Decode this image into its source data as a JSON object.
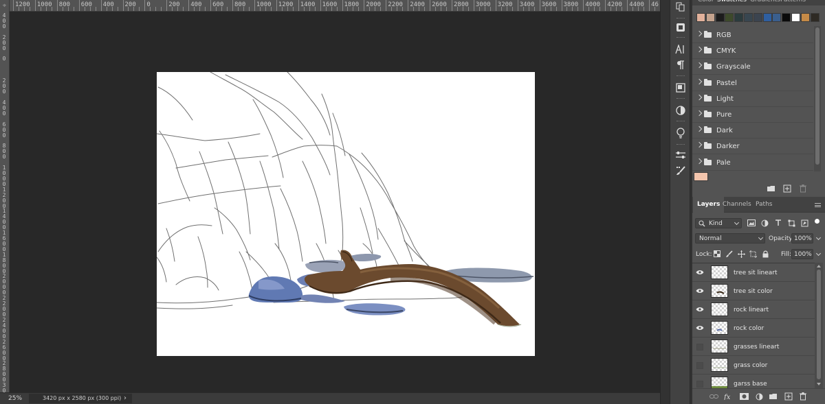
{
  "app": {
    "colors": {
      "workspace": "#282828",
      "panel": "#535353",
      "accent": "#ffffff"
    }
  },
  "ruler": {
    "horizontal_labels": [
      "1200",
      "1000",
      "800",
      "600",
      "400",
      "200",
      "0",
      "200",
      "400",
      "600",
      "800",
      "1000",
      "1200",
      "1400",
      "1600",
      "1800",
      "2000",
      "2200",
      "2400",
      "2600",
      "2800",
      "3000",
      "3200",
      "3400",
      "3600",
      "3800",
      "4000",
      "4200",
      "4400",
      "46"
    ],
    "vertical_labels": [
      "400",
      "200",
      "0",
      "200",
      "400",
      "600",
      "800",
      "1000",
      "1200",
      "1400",
      "1600",
      "1800",
      "2000",
      "2200",
      "2400",
      "2600",
      "2800",
      "3000"
    ]
  },
  "status_bar": {
    "zoom": "25%",
    "doc_info": "3420 px x 2580 px (300 ppi)",
    "arrow": "›"
  },
  "swatches_panel": {
    "tabs": [
      "Color",
      "Swatches",
      "Gradients",
      "Patterns"
    ],
    "active_tab": "Swatches",
    "recent_colors": [
      "#e2b19b",
      "#c4a38e",
      "#1c1c1c",
      "#3d4a2b",
      "#2b3b3d",
      "#384650",
      "#3b444f",
      "#2f5fa0",
      "#3a5f8e",
      "#0a0a0a",
      "#ffffff",
      "#c58a47",
      "#2e2a24"
    ],
    "groups": [
      "RGB",
      "CMYK",
      "Grayscale",
      "Pastel",
      "Light",
      "Pure",
      "Dark",
      "Darker",
      "Pale"
    ],
    "current_swatch": "#f3c5ad"
  },
  "layers_panel": {
    "tabs": [
      "Layers",
      "Channels",
      "Paths"
    ],
    "active_tab": "Layers",
    "filter_kind": "Kind",
    "blend_mode": "Normal",
    "opacity_label": "Opacity:",
    "opacity": "100%",
    "lock_label": "Lock:",
    "fill_label": "Fill:",
    "fill": "100%",
    "layers": [
      {
        "name": "tree sit lineart",
        "visible": true
      },
      {
        "name": "tree sit color",
        "visible": true
      },
      {
        "name": "rock lineart",
        "visible": true
      },
      {
        "name": "rock color",
        "visible": true
      },
      {
        "name": "grasses lineart",
        "visible": false
      },
      {
        "name": "grass color",
        "visible": false
      },
      {
        "name": "garss base",
        "visible": false
      }
    ]
  }
}
